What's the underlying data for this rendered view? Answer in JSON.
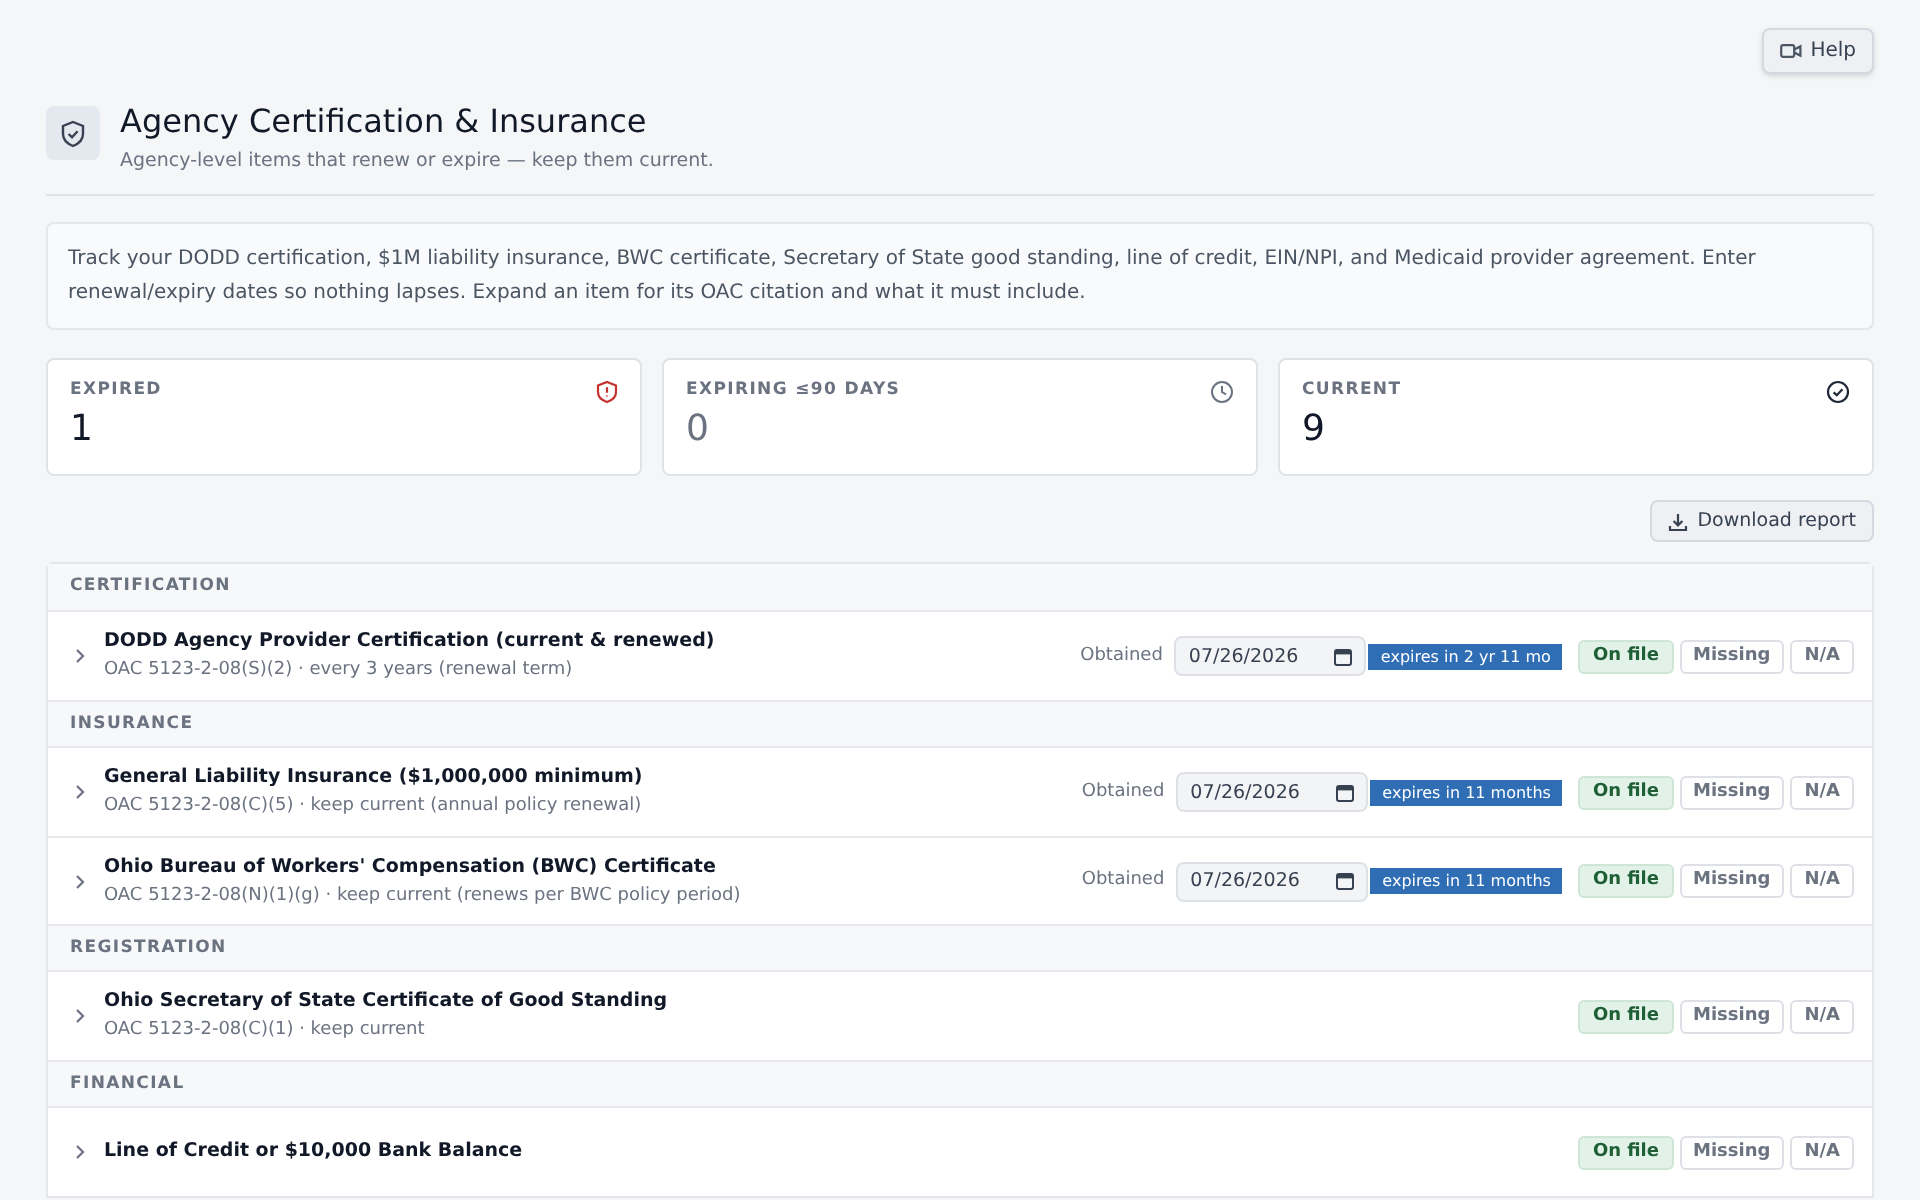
{
  "help_button": {
    "label": "Help"
  },
  "header": {
    "title": "Agency Certification & Insurance",
    "subtitle": "Agency-level items that renew or expire — keep them current."
  },
  "info_text": "Track your DODD certification, $1M liability insurance, BWC certificate, Secretary of State good standing, line of credit, EIN/NPI, and Medicaid provider agreement. Enter renewal/expiry dates so nothing lapses. Expand an item for its OAC citation and what it must include.",
  "stats": [
    {
      "kind": "expired",
      "label": "EXPIRED",
      "value": "1"
    },
    {
      "kind": "expiring",
      "label": "EXPIRING ≤90 DAYS",
      "value": "0"
    },
    {
      "kind": "current",
      "label": "CURRENT",
      "value": "9"
    }
  ],
  "download_button": {
    "label": "Download report"
  },
  "sections": [
    {
      "title": "CERTIFICATION",
      "items": [
        {
          "name": "DODD Agency Provider Certification (current & renewed)",
          "detail": "OAC 5123-2-08(S)(2) · every 3 years (renewal term)",
          "expanded": false,
          "date_label": "Obtained",
          "date": "07/26/2026",
          "expiry": "expires in 2 yr 11 mo",
          "statuses": [
            {
              "label": "On file",
              "selected": true
            },
            {
              "label": "Missing",
              "selected": false
            },
            {
              "label": "N/A",
              "selected": false
            }
          ]
        }
      ]
    },
    {
      "title": "INSURANCE",
      "items": [
        {
          "name": "General Liability Insurance ($1,000,000 minimum)",
          "detail": "OAC 5123-2-08(C)(5) · keep current (annual policy renewal)",
          "expanded": false,
          "date_label": "Obtained",
          "date": "07/26/2026",
          "expiry": "expires in 11 months",
          "statuses": [
            {
              "label": "On file",
              "selected": true
            },
            {
              "label": "Missing",
              "selected": false
            },
            {
              "label": "N/A",
              "selected": false
            }
          ]
        },
        {
          "name": "Ohio Bureau of Workers' Compensation (BWC) Certificate",
          "detail": "OAC 5123-2-08(N)(1)(g) · keep current (renews per BWC policy period)",
          "expanded": false,
          "date_label": "Obtained",
          "date": "07/26/2026",
          "expiry": "expires in 11 months",
          "statuses": [
            {
              "label": "On file",
              "selected": true
            },
            {
              "label": "Missing",
              "selected": false
            },
            {
              "label": "N/A",
              "selected": false
            }
          ]
        }
      ]
    },
    {
      "title": "REGISTRATION",
      "items": [
        {
          "name": "Ohio Secretary of State Certificate of Good Standing",
          "detail": "OAC 5123-2-08(C)(1) · keep current",
          "expanded": false,
          "statuses": [
            {
              "label": "On file",
              "selected": true
            },
            {
              "label": "Missing",
              "selected": false
            },
            {
              "label": "N/A",
              "selected": false
            }
          ]
        }
      ]
    },
    {
      "title": "FINANCIAL",
      "items": [
        {
          "name": "Line of Credit or $10,000 Bank Balance",
          "expanded": false,
          "statuses": [
            {
              "label": "On file",
              "selected": true
            },
            {
              "label": "Missing",
              "selected": false
            },
            {
              "label": "N/A",
              "selected": false
            }
          ]
        }
      ]
    }
  ]
}
